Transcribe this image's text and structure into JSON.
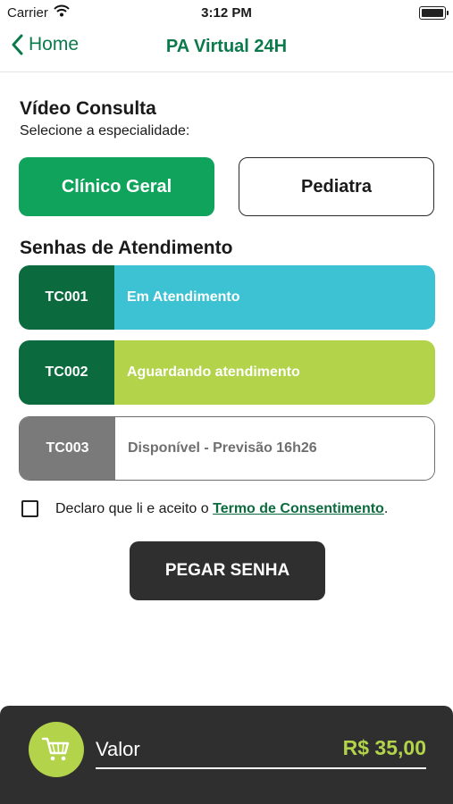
{
  "status_bar": {
    "carrier": "Carrier",
    "time": "3:12 PM"
  },
  "nav": {
    "back_label": "Home",
    "title": "PA Virtual 24H"
  },
  "consult": {
    "heading": "Vídeo Consulta",
    "prompt": "Selecione a especialidade:"
  },
  "specialties": [
    {
      "label": "Clínico Geral",
      "selected": true
    },
    {
      "label": "Pediatra",
      "selected": false
    }
  ],
  "queue": {
    "heading": "Senhas de Atendimento",
    "tickets": [
      {
        "code": "TC001",
        "status": "Em Atendimento"
      },
      {
        "code": "TC002",
        "status": "Aguardando atendimento"
      },
      {
        "code": "TC003",
        "status": "Disponível - Previsão 16h26"
      }
    ]
  },
  "consent": {
    "text": "Declaro que li e aceito o ",
    "link": "Termo de Consentimento",
    "end": ".",
    "checked": false
  },
  "action": {
    "label": "PEGAR SENHA"
  },
  "footer": {
    "label": "Valor",
    "price": "R$ 35,00",
    "icon": "cart-icon"
  },
  "colors": {
    "brand_green": "#0b7a4b",
    "accent_green": "#0fa35c",
    "dark_green": "#0b6b3e",
    "cyan": "#3dc2d3",
    "lime": "#b2d34a",
    "gray": "#7a7a7a",
    "dark": "#2f2f2f"
  }
}
